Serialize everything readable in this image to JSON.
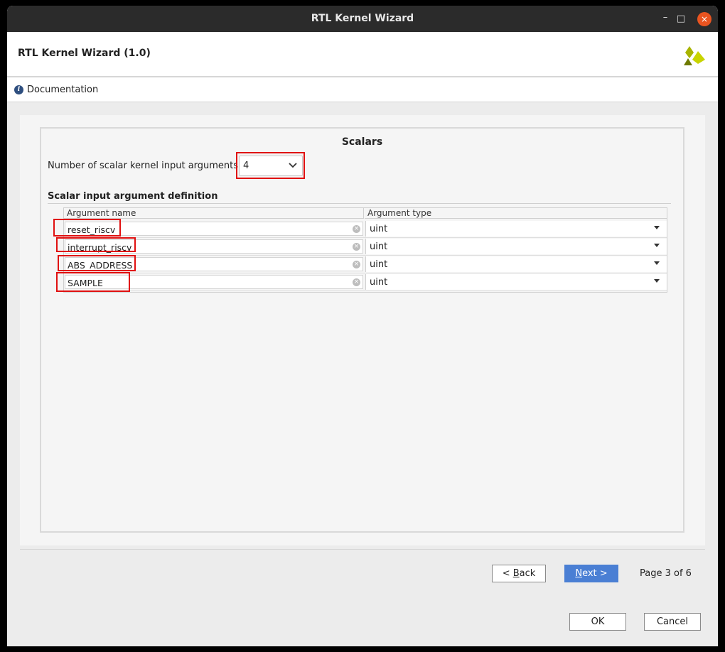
{
  "window": {
    "title": "RTL Kernel Wizard",
    "controls": {
      "minimize": "–",
      "maximize": "□",
      "close": "×"
    }
  },
  "header": {
    "title": "RTL Kernel Wizard (1.0)",
    "logo": "xilinx-logo"
  },
  "docbar": {
    "icon": "info-icon",
    "label": "Documentation"
  },
  "scalars": {
    "title": "Scalars",
    "num_label": "Number of scalar kernel input arguments",
    "num_value": "4",
    "section_title": "Scalar input argument definition",
    "columns": {
      "name": "Argument name",
      "type": "Argument type"
    },
    "rows": [
      {
        "name": "reset_riscv",
        "type": "uint"
      },
      {
        "name": "interrupt_riscv",
        "type": "uint"
      },
      {
        "name": "ABS_ADDRESS",
        "type": "uint"
      },
      {
        "name": "SAMPLE",
        "type": "uint"
      }
    ]
  },
  "nav": {
    "back_prefix": "< ",
    "back_key": "B",
    "back_rest": "ack",
    "next_key": "N",
    "next_rest": "ext >",
    "page_info": "Page 3 of 6"
  },
  "footer": {
    "ok": "OK",
    "cancel": "Cancel"
  },
  "colors": {
    "titlebar": "#2b2b2b",
    "close_button": "#e95420",
    "primary_button": "#4a7fd4",
    "highlight": "#e01010"
  }
}
